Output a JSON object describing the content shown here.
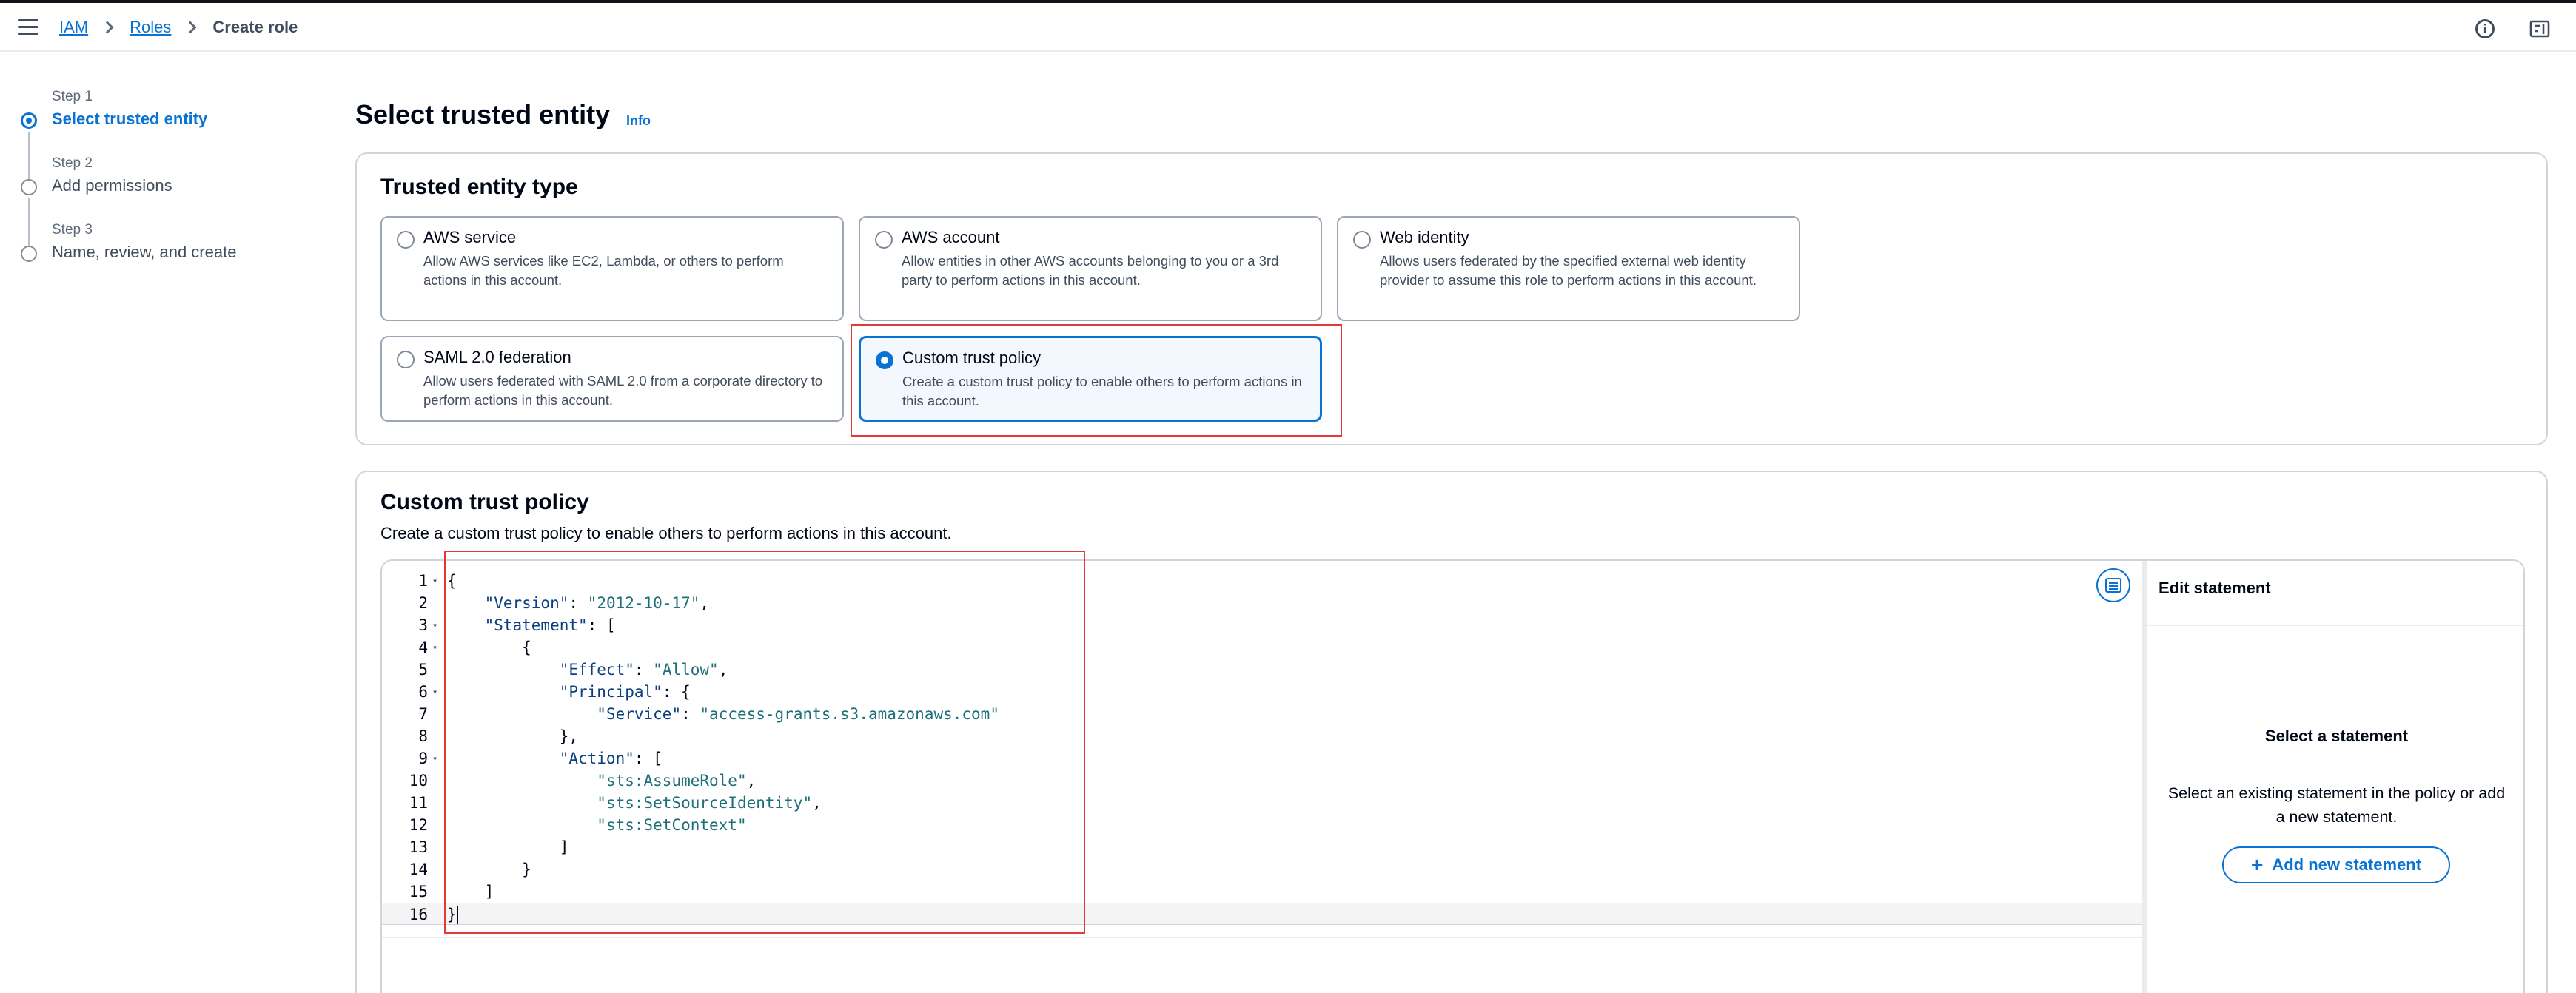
{
  "breadcrumb": {
    "iam": "IAM",
    "roles": "Roles",
    "current": "Create role"
  },
  "topbar": {
    "menu_icon": "hamburger-menu-icon",
    "info_icon": "info-circle-icon",
    "info_glyph": "i",
    "settings_icon": "settings-panel-icon"
  },
  "steps": [
    {
      "num": "Step 1",
      "title": "Select trusted entity",
      "active": true
    },
    {
      "num": "Step 2",
      "title": "Add permissions",
      "active": false
    },
    {
      "num": "Step 3",
      "title": "Name, review, and create",
      "active": false
    }
  ],
  "page": {
    "title": "Select trusted entity",
    "info": "Info"
  },
  "trusted_entity": {
    "title": "Trusted entity type",
    "options": [
      {
        "title": "AWS service",
        "desc": "Allow AWS services like EC2, Lambda, or others to perform actions in this account.",
        "selected": false
      },
      {
        "title": "AWS account",
        "desc": "Allow entities in other AWS accounts belonging to you or a 3rd party to perform actions in this account.",
        "selected": false
      },
      {
        "title": "Web identity",
        "desc": "Allows users federated by the specified external web identity provider to assume this role to perform actions in this account.",
        "selected": false
      },
      {
        "title": "SAML 2.0 federation",
        "desc": "Allow users federated with SAML 2.0 from a corporate directory to perform actions in this account.",
        "selected": false
      },
      {
        "title": "Custom trust policy",
        "desc": "Create a custom trust policy to enable others to perform actions in this account.",
        "selected": true
      }
    ]
  },
  "custom_policy": {
    "title": "Custom trust policy",
    "desc": "Create a custom trust policy to enable others to perform actions in this account.",
    "code_lines": [
      {
        "n": "1",
        "fold": true,
        "text": "{"
      },
      {
        "n": "2",
        "fold": false,
        "text": "    \"Version\": \"2012-10-17\","
      },
      {
        "n": "3",
        "fold": true,
        "text": "    \"Statement\": ["
      },
      {
        "n": "4",
        "fold": true,
        "text": "        {"
      },
      {
        "n": "5",
        "fold": false,
        "text": "            \"Effect\": \"Allow\","
      },
      {
        "n": "6",
        "fold": true,
        "text": "            \"Principal\": {"
      },
      {
        "n": "7",
        "fold": false,
        "text": "                \"Service\": \"access-grants.s3.amazonaws.com\""
      },
      {
        "n": "8",
        "fold": false,
        "text": "            },"
      },
      {
        "n": "9",
        "fold": true,
        "text": "            \"Action\": ["
      },
      {
        "n": "10",
        "fold": false,
        "text": "                \"sts:AssumeRole\","
      },
      {
        "n": "11",
        "fold": false,
        "text": "                \"sts:SetSourceIdentity\","
      },
      {
        "n": "12",
        "fold": false,
        "text": "                \"sts:SetContext\""
      },
      {
        "n": "13",
        "fold": false,
        "text": "            ]"
      },
      {
        "n": "14",
        "fold": false,
        "text": "        }"
      },
      {
        "n": "15",
        "fold": false,
        "text": "    ]"
      },
      {
        "n": "16",
        "fold": false,
        "text": "}"
      }
    ],
    "active_line": 16,
    "format_icon": "format-document-icon"
  },
  "edit_statement": {
    "header": "Edit statement",
    "title": "Select a statement",
    "desc": "Select an existing statement in the policy or add a new statement.",
    "add_button": "Add new statement",
    "add_glyph": "+"
  },
  "colors": {
    "accent": "#0972d3",
    "highlight": "#e53935",
    "key": "#0b3f7d",
    "string": "#1f6f7a"
  }
}
